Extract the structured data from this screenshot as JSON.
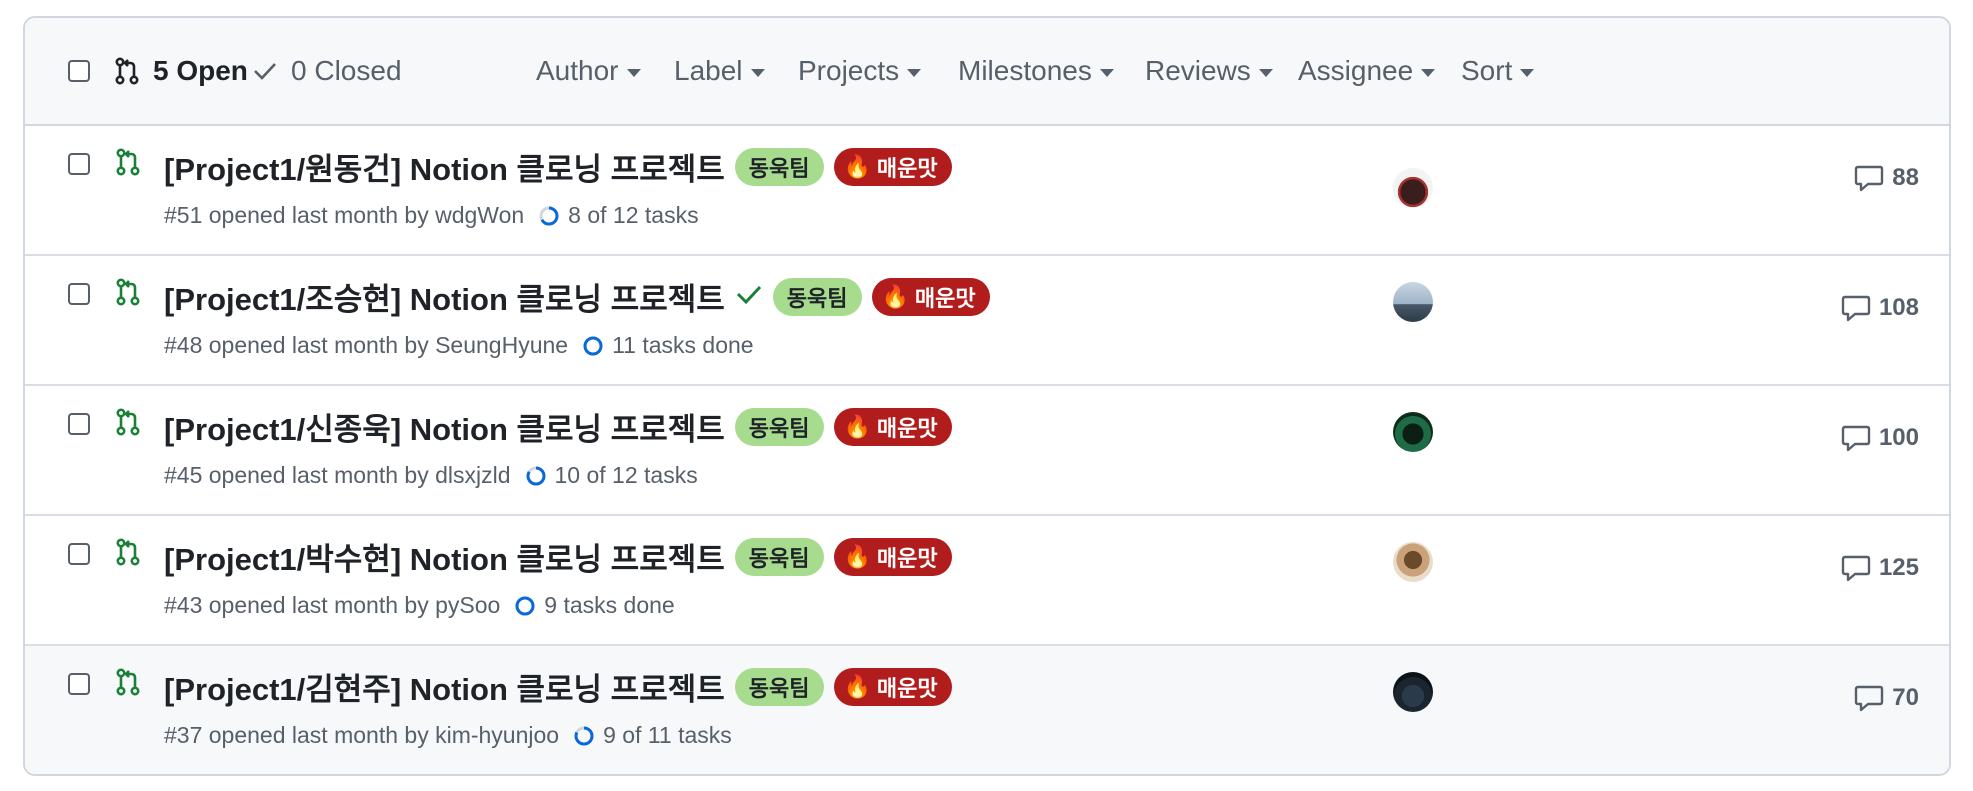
{
  "header": {
    "open_label": "5 Open",
    "closed_label": "0 Closed",
    "filters": [
      {
        "label": "Author",
        "name": "author-filter"
      },
      {
        "label": "Label",
        "name": "label-filter"
      },
      {
        "label": "Projects",
        "name": "projects-filter"
      },
      {
        "label": "Milestones",
        "name": "milestones-filter"
      },
      {
        "label": "Reviews",
        "name": "reviews-filter"
      },
      {
        "label": "Assignee",
        "name": "assignee-filter"
      },
      {
        "label": "Sort",
        "name": "sort-filter"
      }
    ]
  },
  "labels": {
    "team": "동욱팀",
    "spicy": "매운맛"
  },
  "colors": {
    "open_green": "#1a7f37",
    "label_green": "#a7dc8f",
    "label_red": "#b11c1c",
    "progress_blue": "#0969da"
  },
  "pull_requests": [
    {
      "title": "[Project1/원동건] Notion 클로닝 프로젝트",
      "meta": "#51 opened last month by wdgWon",
      "progress": "8 of 12 tasks",
      "progress_fraction": 0.667,
      "comments": "88",
      "checked": false
    },
    {
      "title": "[Project1/조승현] Notion 클로닝 프로젝트",
      "meta": "#48 opened last month by SeungHyune",
      "progress": "11 tasks done",
      "progress_fraction": 1.0,
      "comments": "108",
      "checked": true
    },
    {
      "title": "[Project1/신종욱] Notion 클로닝 프로젝트",
      "meta": "#45 opened last month by dlsxjzld",
      "progress": "10 of 12 tasks",
      "progress_fraction": 0.833,
      "comments": "100",
      "checked": false
    },
    {
      "title": "[Project1/박수현] Notion 클로닝 프로젝트",
      "meta": "#43 opened last month by pySoo",
      "progress": "9 tasks done",
      "progress_fraction": 1.0,
      "comments": "125",
      "checked": false
    },
    {
      "title": "[Project1/김현주] Notion 클로닝 프로젝트",
      "meta": "#37 opened last month by kim-hyunjoo",
      "progress": "9 of 11 tasks",
      "progress_fraction": 0.818,
      "comments": "70",
      "checked": false
    }
  ]
}
